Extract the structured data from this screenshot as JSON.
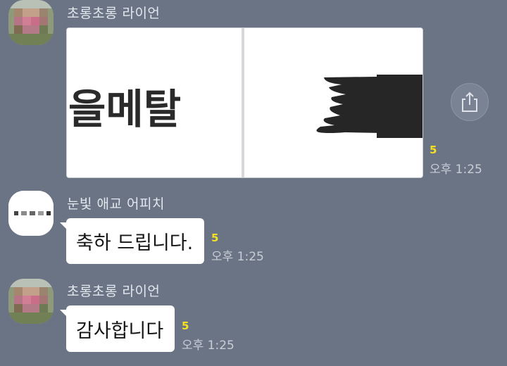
{
  "messages": [
    {
      "sender": "초롱초롱 라이언",
      "image_text": "을메탈",
      "unread": "5",
      "time": "오후 1:25"
    },
    {
      "sender": "눈빛 애교 어피치",
      "text": "축하 드립니다.",
      "unread": "5",
      "time": "오후 1:25"
    },
    {
      "sender": "초롱초롱 라이언",
      "text": "감사합니다",
      "unread": "5",
      "time": "오후 1:25"
    }
  ],
  "icons": {
    "share": "share-icon",
    "avatar_1": "avatar",
    "avatar_2": "avatar",
    "avatar_3": "avatar"
  },
  "colors": {
    "background": "#6a7485",
    "unread": "#f7e21f",
    "bubble": "#ffffff"
  }
}
